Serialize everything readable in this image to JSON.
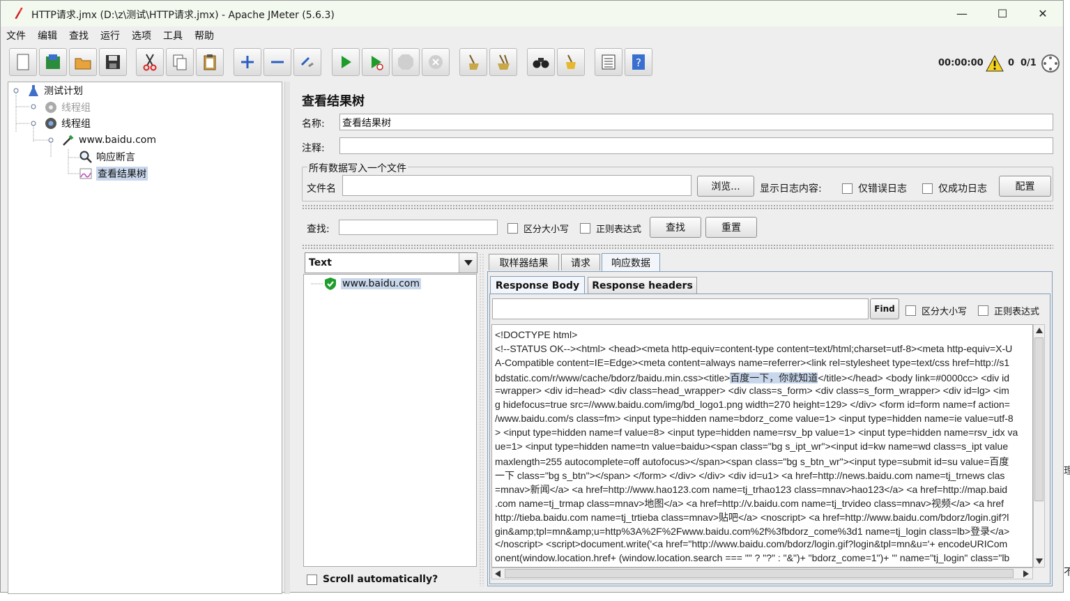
{
  "window": {
    "title": "HTTP请求.jmx (D:\\z\\测试\\HTTP请求.jmx) - Apache JMeter (5.6.3)",
    "min": "—",
    "max": "☐",
    "close": "✕"
  },
  "menu": [
    "文件",
    "编辑",
    "查找",
    "运行",
    "选项",
    "工具",
    "帮助"
  ],
  "status": {
    "time": "00:00:00",
    "warnings": "0",
    "threads": "0/1"
  },
  "tree": [
    {
      "label": "测试计划"
    },
    {
      "label": "线程组"
    },
    {
      "label": "线程组"
    },
    {
      "label": "www.baidu.com"
    },
    {
      "label": "响应断言"
    },
    {
      "label": "查看结果树"
    }
  ],
  "panel": {
    "title": "查看结果树",
    "name_label": "名称:",
    "name_value": "查看结果树",
    "comment_label": "注释:",
    "comment_value": "",
    "file_group": "所有数据写入一个文件",
    "file_label": "文件名",
    "file_value": "",
    "browse": "浏览...",
    "log_label": "显示日志内容:",
    "errors_only": "仅错误日志",
    "success_only": "仅成功日志",
    "configure": "配置"
  },
  "search": {
    "label": "查找:",
    "value": "",
    "case": "区分大小写",
    "regex": "正则表达式",
    "find": "查找",
    "reset": "重置"
  },
  "renderer": {
    "selected": "Text"
  },
  "results": [
    {
      "label": "www.baidu.com"
    }
  ],
  "scroll_auto": "Scroll automatically?",
  "tabs": [
    "取样器结果",
    "请求",
    "响应数据"
  ],
  "subtabs": [
    "Response Body",
    "Response headers"
  ],
  "body_search": {
    "value": "",
    "find": "Find",
    "case": "区分大小写",
    "regex": "正则表达式"
  },
  "body_lines": [
    "<!DOCTYPE html>",
    "<!--STATUS OK--><html> <head><meta http-equiv=content-type content=text/html;charset=utf-8><meta http-equiv=X-U",
    "A-Compatible content=IE=Edge><meta content=always name=referrer><link rel=stylesheet type=text/css href=http://s1",
    "bdstatic.com/r/www/cache/bdorz/baidu.min.css><title>",
    "=wrapper> <div id=head> <div class=head_wrapper> <div class=s_form> <div class=s_form_wrapper> <div id=lg> <im",
    "g hidefocus=true src=//www.baidu.com/img/bd_logo1.png width=270 height=129> </div> <form id=form name=f action=",
    "/www.baidu.com/s class=fm> <input type=hidden name=bdorz_come value=1> <input type=hidden name=ie value=utf-8",
    "> <input type=hidden name=f value=8> <input type=hidden name=rsv_bp value=1> <input type=hidden name=rsv_idx va",
    "ue=1> <input type=hidden name=tn value=baidu><span class=\"bg s_ipt_wr\"><input id=kw name=wd class=s_ipt value",
    "maxlength=255 autocomplete=off autofocus></span><span class=\"bg s_btn_wr\"><input type=submit id=su value=百度",
    "一下 class=\"bg s_btn\"></span> </form> </div> </div> <div id=u1> <a href=http://news.baidu.com name=tj_trnews clas",
    "=mnav>新闻</a> <a href=http://www.hao123.com name=tj_trhao123 class=mnav>hao123</a> <a href=http://map.baid",
    ".com name=tj_trmap class=mnav>地图</a> <a href=http://v.baidu.com name=tj_trvideo class=mnav>视频</a> <a href",
    "http://tieba.baidu.com name=tj_trtieba class=mnav>贴吧</a> <noscript> <a href=http://www.baidu.com/bdorz/login.gif?l",
    "gin&amp;tpl=mn&amp;u=http%3A%2F%2Fwww.baidu.com%2f%3fbdorz_come%3d1 name=tj_login class=lb>登录</a>",
    "</noscript> <script>document.write('<a href=\"http://www.baidu.com/bdorz/login.gif?login&tpl=mn&u='+ encodeURICom",
    "onent(window.location.href+ (window.location.search === \"\" ? \"?\" : \"&\")+ \"bdorz_come=1\")+ '\" name=\"tj_login\" class=\"lb"
  ],
  "body_hl": {
    "highlight": "百度一下，你就知道",
    "after": "</title></head> <body link=#0000cc> <div id"
  }
}
